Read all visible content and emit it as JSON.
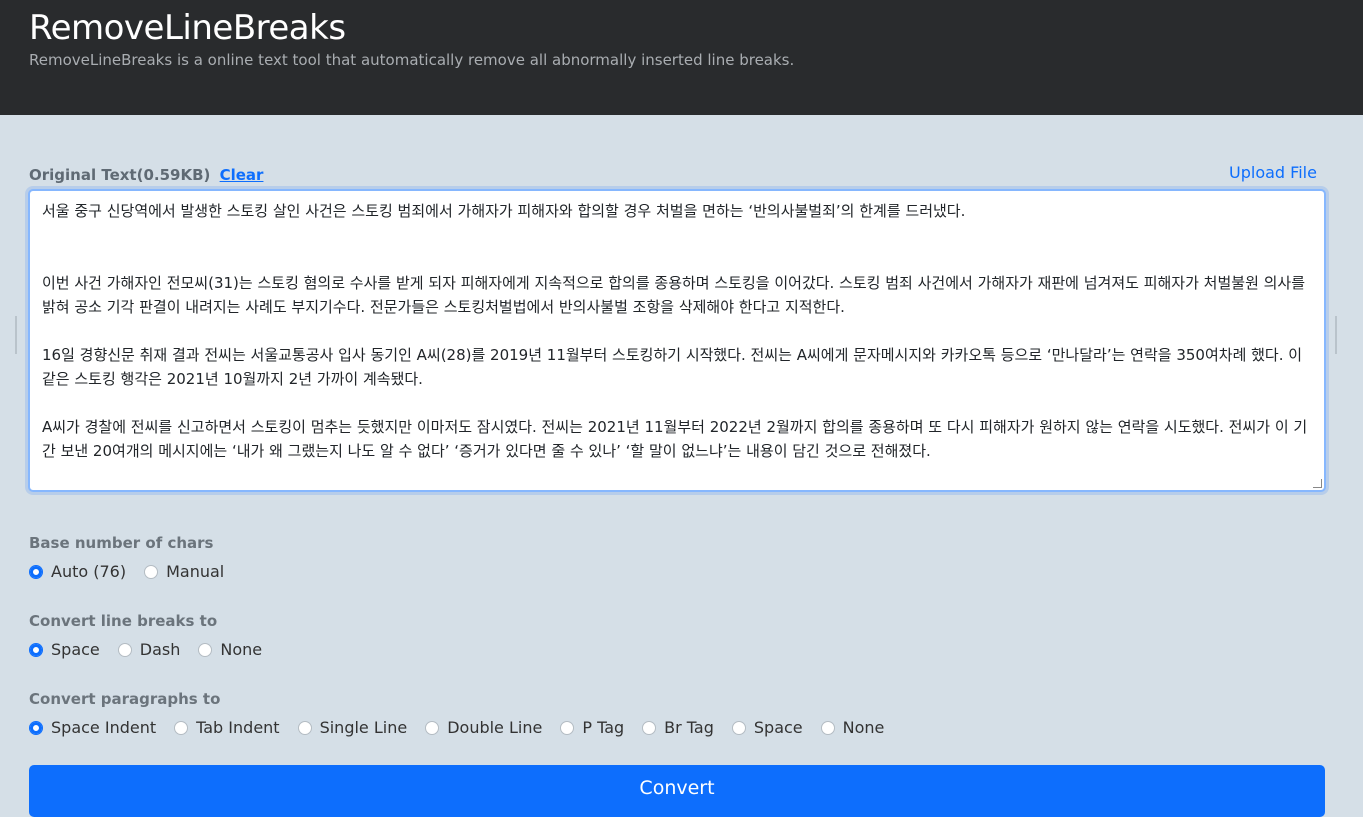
{
  "header": {
    "title": "RemoveLineBreaks",
    "subtitle": "RemoveLineBreaks is a online text tool that automatically remove all abnormally inserted line breaks."
  },
  "input": {
    "label": "Original Text(0.59KB)",
    "clear_label": "Clear",
    "upload_label": "Upload File",
    "paragraphs": [
      "서울 중구 신당역에서 발생한 스토킹 살인 사건은 스토킹 범죄에서 가해자가 피해자와 합의할 경우 처벌을 면하는 ‘반의사불벌죄’의 한계를 드러냈다.",
      "이번 사건 가해자인 전모씨(31)는 스토킹 혐의로 수사를 받게 되자 피해자에게 지속적으로 합의를 종용하며 스토킹을 이어갔다. 스토킹 범죄 사건에서 가해자가 재판에 넘겨져도 피해자가 처벌불원 의사를 밝혀 공소 기각 판결이 내려지는 사례도 부지기수다. 전문가들은 스토킹처벌법에서 반의사불벌 조항을 삭제해야 한다고 지적한다.",
      "16일 경향신문 취재 결과 전씨는 서울교통공사 입사 동기인 A씨(28)를 2019년 11월부터 스토킹하기 시작했다. 전씨는 A씨에게 문자메시지와 카카오톡 등으로 ‘만나달라’는 연락을 350여차례 했다. 이 같은 스토킹 행각은 2021년 10월까지 2년 가까이 계속됐다.",
      "A씨가 경찰에 전씨를 신고하면서 스토킹이 멈추는 듯했지만 이마저도 잠시였다. 전씨는 2021년 11월부터 2022년 2월까지 합의를 종용하며 또 다시 피해자가 원하지 않는 연락을 시도했다. 전씨가 이 기간 보낸 20여개의 메시지에는 ‘내가 왜 그랬는지 나도 알 수 없다’ ‘증거가 있다면 줄 수 있나’ ‘할 말이 없느냐’는 내용이 담긴 것으로 전해졌다."
    ]
  },
  "base_chars": {
    "label": "Base number of chars",
    "options": [
      "Auto (76)",
      "Manual"
    ],
    "selected": "Auto (76)"
  },
  "line_breaks": {
    "label": "Convert line breaks to",
    "options": [
      "Space",
      "Dash",
      "None"
    ],
    "selected": "Space"
  },
  "paragraphs": {
    "label": "Convert paragraphs to",
    "options": [
      "Space Indent",
      "Tab Indent",
      "Single Line",
      "Double Line",
      "P Tag",
      "Br Tag",
      "Space",
      "None"
    ],
    "selected": "Space Indent"
  },
  "convert_label": "Convert",
  "colors": {
    "header_bg": "#292b2d",
    "page_bg": "#d5dfe7",
    "accent": "#0d6efd"
  }
}
